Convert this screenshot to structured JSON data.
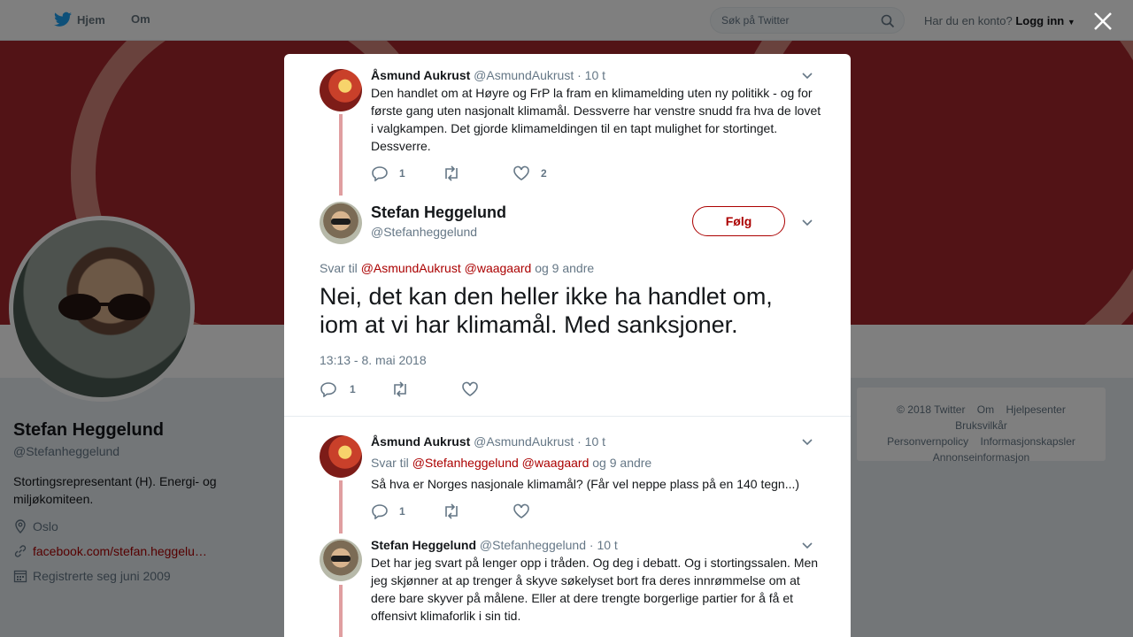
{
  "topbar": {
    "home_label": "Hjem",
    "about_label": "Om",
    "search_placeholder": "Søk på Twitter",
    "account_question": "Har du en konto?",
    "login_label": "Logg inn"
  },
  "profile": {
    "name": "Stefan Heggelund",
    "handle": "@Stefanheggelund",
    "bio": "Stortingsrepresentant (H). Energi- og miljøkomiteen.",
    "location": "Oslo",
    "link": "facebook.com/stefan.heggelu…",
    "joined": "Registrerte seg juni 2009"
  },
  "footer": {
    "copyright": "© 2018 Twitter",
    "links": [
      "Om",
      "Hjelpesenter",
      "Bruksvilkår",
      "Personvernpolicy",
      "Informasjonskapsler",
      "Annonseinformasjon"
    ]
  },
  "colors": {
    "accent": "#ab0000",
    "thread_line": "#e09ea0"
  },
  "modal": {
    "tweet1": {
      "name": "Åsmund Aukrust",
      "handle": "@AsmundAukrust",
      "time": "· 10 t",
      "text": "Den handlet om at Høyre og FrP la fram en klimamelding uten ny politikk - og for første gang uten nasjonalt klimamål. Dessverre har venstre snudd fra hva de lovet i valgkampen. Det gjorde klimameldingen til en tapt mulighet for stortinget. Dessverre.",
      "replies": "1",
      "likes": "2"
    },
    "main": {
      "name": "Stefan Heggelund",
      "handle": "@Stefanheggelund",
      "follow_label": "Følg",
      "reply_prefix": "Svar til",
      "reply_mention1": "@AsmundAukrust",
      "reply_mention2": "@waagaard",
      "reply_suffix": "og 9 andre",
      "text": "Nei, det kan den heller ikke ha handlet om, iom at vi har klimamål. Med sanksjoner.",
      "timestamp": "13:13 - 8. mai 2018",
      "replies": "1"
    },
    "tweet3": {
      "name": "Åsmund Aukrust",
      "handle": "@AsmundAukrust",
      "time": "· 10 t",
      "reply_prefix": "Svar til",
      "reply_mention1": "@Stefanheggelund",
      "reply_mention2": "@waagaard",
      "reply_suffix": "og 9 andre",
      "text": "Så hva er Norges nasjonale klimamål? (Får vel neppe plass på en 140 tegn...)",
      "replies": "1"
    },
    "tweet4": {
      "name": "Stefan Heggelund",
      "handle": "@Stefanheggelund",
      "time": "· 10 t",
      "text": "Det har jeg svart på lenger opp i tråden. Og deg i debatt. Og i stortingssalen. Men jeg skjønner at ap trenger å skyve søkelyset bort fra deres innrømmelse om at dere bare skyver på målene. Eller at dere trengte borgerlige partier for å få et offensivt klimaforlik i sin tid."
    }
  }
}
